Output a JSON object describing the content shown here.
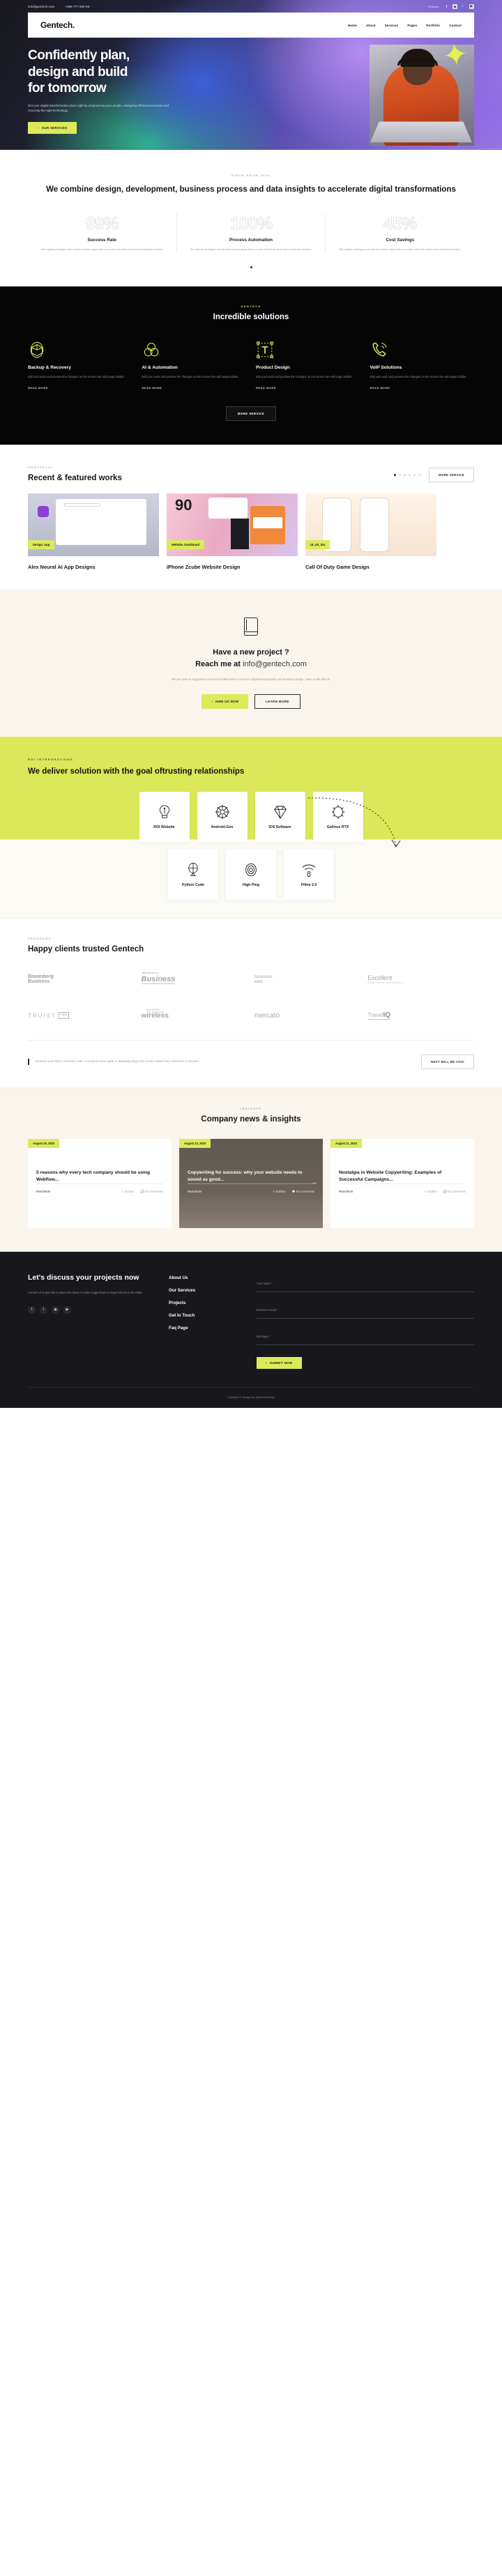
{
  "topbar": {
    "email": "info@gentech.com",
    "phone": "+888 777 560 55",
    "follows_label": "Follows:",
    "social": [
      "facebook-icon",
      "instagram-icon",
      "twitter-icon",
      "youtube-icon"
    ]
  },
  "header": {
    "logo": "Gentech.",
    "nav": [
      "Home",
      "About",
      "Services",
      "Pages",
      "Portfolio",
      "Contact"
    ]
  },
  "hero": {
    "title_line1": "Confidently plan,",
    "title_line2": "design and build",
    "title_line3": "for tomorrow",
    "paragraph": "Get your digital transformation done right by empowering your people, designing efficient processes and choosing the right technology.",
    "cta": "OUR SERVICES"
  },
  "stats": {
    "label": "SINCE FROM 2000",
    "heading": "We combine design, development, business process and data insights to accelerate digital transformations",
    "items": [
      {
        "number": "99%",
        "title": "Success Rate",
        "desc": "We rapidly prototype and launch custom apps with no-code tools that move your business forward."
      },
      {
        "number": "100%",
        "title": "Process Automation",
        "desc": "We rapidly prototype and launch custom apps with no-code tools that move your business forward."
      },
      {
        "number": "45%",
        "title": "Cost Savings",
        "desc": "We rapidly prototype and launch custom apps with no-code tools that move your business forward."
      }
    ]
  },
  "solutions": {
    "label": "GENTECH",
    "heading": "Incredible solutions",
    "read_more": "READ MORE",
    "items": [
      {
        "icon": "cube-icon",
        "title": "Backup & Recovery",
        "desc": "Edit your work and preview the changes on the screen live with page builder."
      },
      {
        "icon": "venn-circles-icon",
        "title": "AI & Automation",
        "desc": "Edit your work and preview the changes on the screen live with page builder."
      },
      {
        "icon": "text-tool-icon",
        "title": "Product Design",
        "desc": "Edit your work and preview the changes on the screen live with page builder."
      },
      {
        "icon": "phone-ring-icon",
        "title": "VoIP Solutions",
        "desc": "Edit your work and preview the changes on the screen live with page builder."
      }
    ],
    "more_button": "MORE SERVICE"
  },
  "portfolio": {
    "label": "PORTFOLIO",
    "heading": "Recent & featured works",
    "more_button": "MORE SERVICE",
    "items": [
      {
        "tag": "Design, App",
        "title": "Alex Neural AI App Designs"
      },
      {
        "tag": "Website, Dashboard",
        "title": "iPhone Zcube Website Design"
      },
      {
        "tag": "UI, UX, IOs",
        "title": "Call Of Duty Game Design"
      }
    ]
  },
  "project_cta": {
    "icon": "book-icon",
    "line1": "Have a new project ?",
    "line2_bold": "Reach me at",
    "line2_light": "info@gentech.com",
    "paragraph": "We are open to suggestion and very flexible when it comes to digital photography and branding design. Have a talk with us.",
    "primary_button": "HIRE US NOW",
    "secondary_button": "LEARN MORE"
  },
  "roi": {
    "label": "ROI INTREGRATIONS",
    "heading": "We deliver solution with the goal oftrusting relationships",
    "tiles_row1": [
      {
        "icon": "lightbulb-icon",
        "title": "ROI Website"
      },
      {
        "icon": "ships-wheel-icon",
        "title": "Android-Gen"
      },
      {
        "icon": "diamond-icon",
        "title": "IOS Software"
      },
      {
        "icon": "gear-sun-icon",
        "title": "Geforce RTX"
      }
    ],
    "tiles_row2": [
      {
        "icon": "globe-stand-icon",
        "title": "Python Code"
      },
      {
        "icon": "target-icon",
        "title": "High Ping"
      },
      {
        "icon": "wifi-icon",
        "title": "Fifine 2.0"
      }
    ]
  },
  "clients": {
    "label": "SPONSORS",
    "heading": "Happy clients trusted Gentech",
    "logos": [
      {
        "name": "Bloomberg Business",
        "line1": "Bloomberg",
        "line2": "Business"
      },
      {
        "name": "Business to Business",
        "small": "Business to",
        "main": "Business"
      },
      {
        "name": "business web",
        "line1": "business",
        "line2": "web"
      },
      {
        "name": "Excellent business software",
        "main": "Excellent",
        "sub": "business software"
      },
      {
        "name": "TRUIST HH",
        "main": "TRUIST",
        "badge": "HH"
      },
      {
        "name": "wireless",
        "small": "BUSINESS TECHNOLOGY",
        "main": "wireless"
      },
      {
        "name": "mercato",
        "main": "mercató"
      },
      {
        "name": "TravelIQ",
        "pre": "Travel",
        "post": "IQ"
      }
    ],
    "quote": "Increase your blog's conversion rate: a comprehensive guide to designing blogs that convert visitors into customers in Gentech.",
    "quote_button": "NEXT WILL BE YOU!"
  },
  "blog": {
    "label": "INSIGHTS",
    "heading": "Company news & insights",
    "posts": [
      {
        "date": "August 16, 2023",
        "title": "5 reasons why every tech company should be using Webflow...",
        "read_more": "Read More",
        "author": "Subhan",
        "comments": "No Comments"
      },
      {
        "date": "August 13, 2023",
        "title": "Copywriting for success: why your website needs to sound as good...",
        "read_more": "Read More",
        "author": "Subhan",
        "comments": "No Comments"
      },
      {
        "date": "August 11, 2023",
        "title": "Nostalgia in Website Copywriting: Examples of Successful Campaigns...",
        "read_more": "Read More",
        "author": "Subhan",
        "comments": "No Comments"
      }
    ]
  },
  "footer": {
    "heading": "Let's discuss your projects now",
    "paragraph": "Contact us to give life to awesome ideas or make suggestions or requirements to be made.",
    "social": [
      "facebook-icon",
      "twitter-icon",
      "instagram-icon",
      "youtube-icon"
    ],
    "links": [
      "About Us",
      "Our Services",
      "Projects",
      "Get In Touch",
      "Faq Page"
    ],
    "form": {
      "name_label": "Your name *",
      "email_label": "Business email *",
      "message_label": "Message *",
      "submit": "SUBMIT NOW"
    },
    "copyright": "Copyright © design By @DivineDesign"
  }
}
